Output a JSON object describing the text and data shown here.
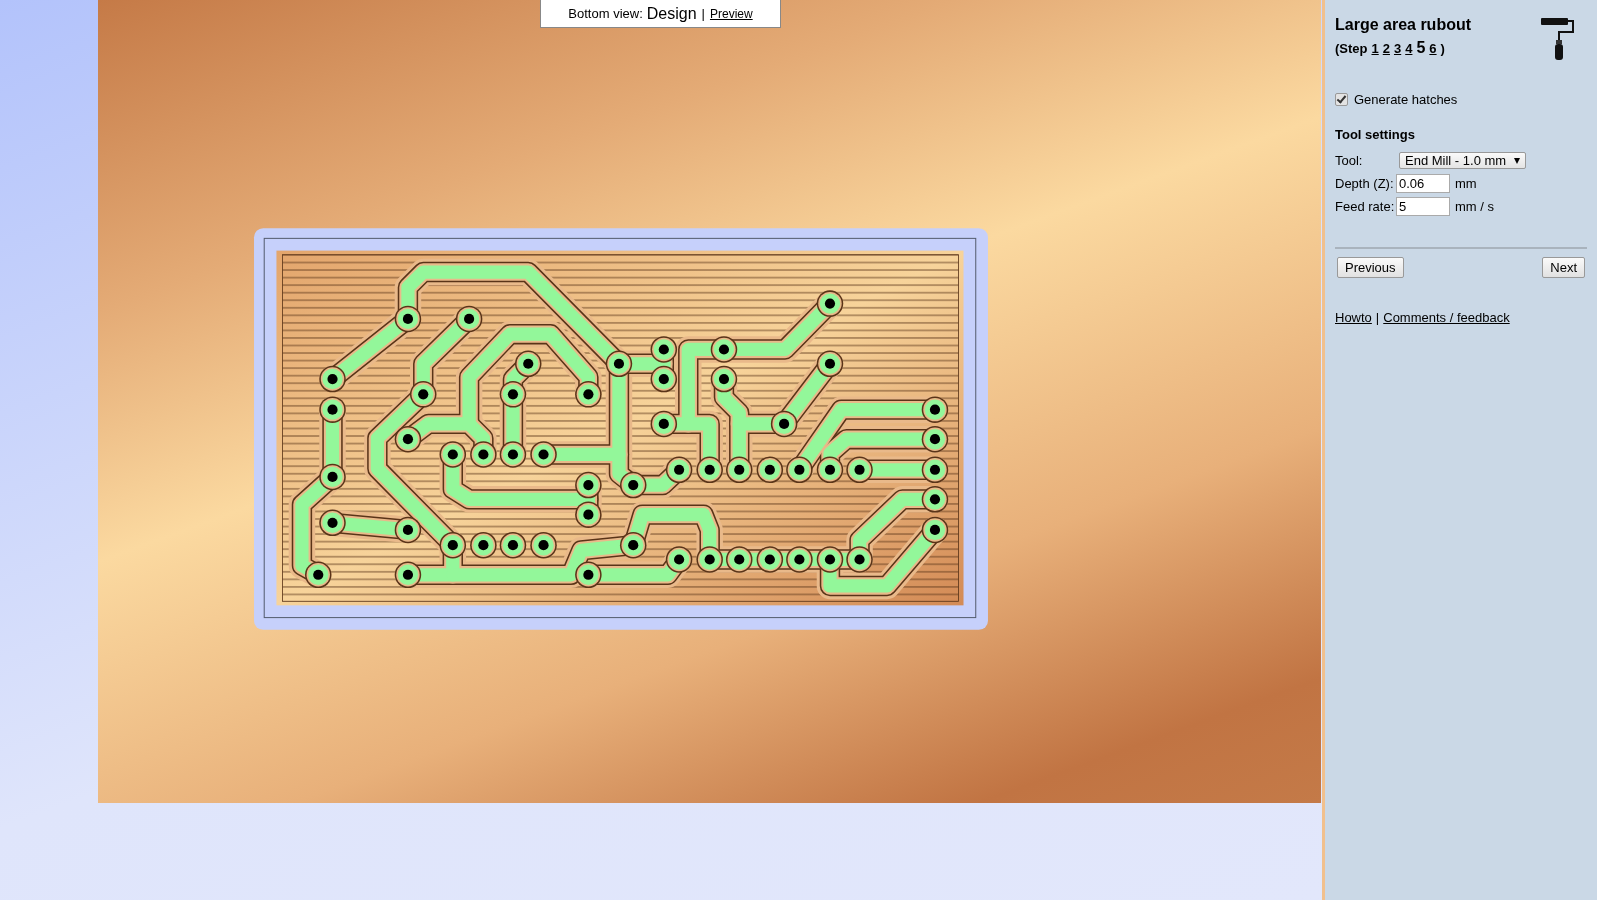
{
  "view_switcher": {
    "label": "Bottom view:",
    "separator": "|",
    "options": [
      {
        "label": "Design",
        "selected": true
      },
      {
        "label": "Preview",
        "selected": false
      }
    ]
  },
  "panel": {
    "title": "Large area rubout",
    "step_prefix": "(Step",
    "step_suffix": ")",
    "steps": [
      {
        "label": "1",
        "selected": false
      },
      {
        "label": "2",
        "selected": false
      },
      {
        "label": "3",
        "selected": false
      },
      {
        "label": "4",
        "selected": false
      },
      {
        "label": "5",
        "selected": true
      },
      {
        "label": "6",
        "selected": false
      }
    ],
    "option": {
      "label": "Generate hatches",
      "checked": true
    },
    "section_title": "Tool settings",
    "fields": [
      {
        "kind": "select",
        "label": "Tool:",
        "value": "End Mill - 1.0 mm"
      },
      {
        "kind": "input",
        "label": "Depth (Z):",
        "value": "0.06",
        "unit": "mm"
      },
      {
        "kind": "input",
        "label": "Feed rate:",
        "value": "5",
        "unit": "mm / s"
      }
    ],
    "buttons": [
      {
        "label": "Previous"
      },
      {
        "label": "Next"
      }
    ],
    "links": [
      {
        "label": "Howto"
      },
      {
        "label": "Comments / feedback"
      }
    ],
    "link_separator": "|"
  }
}
